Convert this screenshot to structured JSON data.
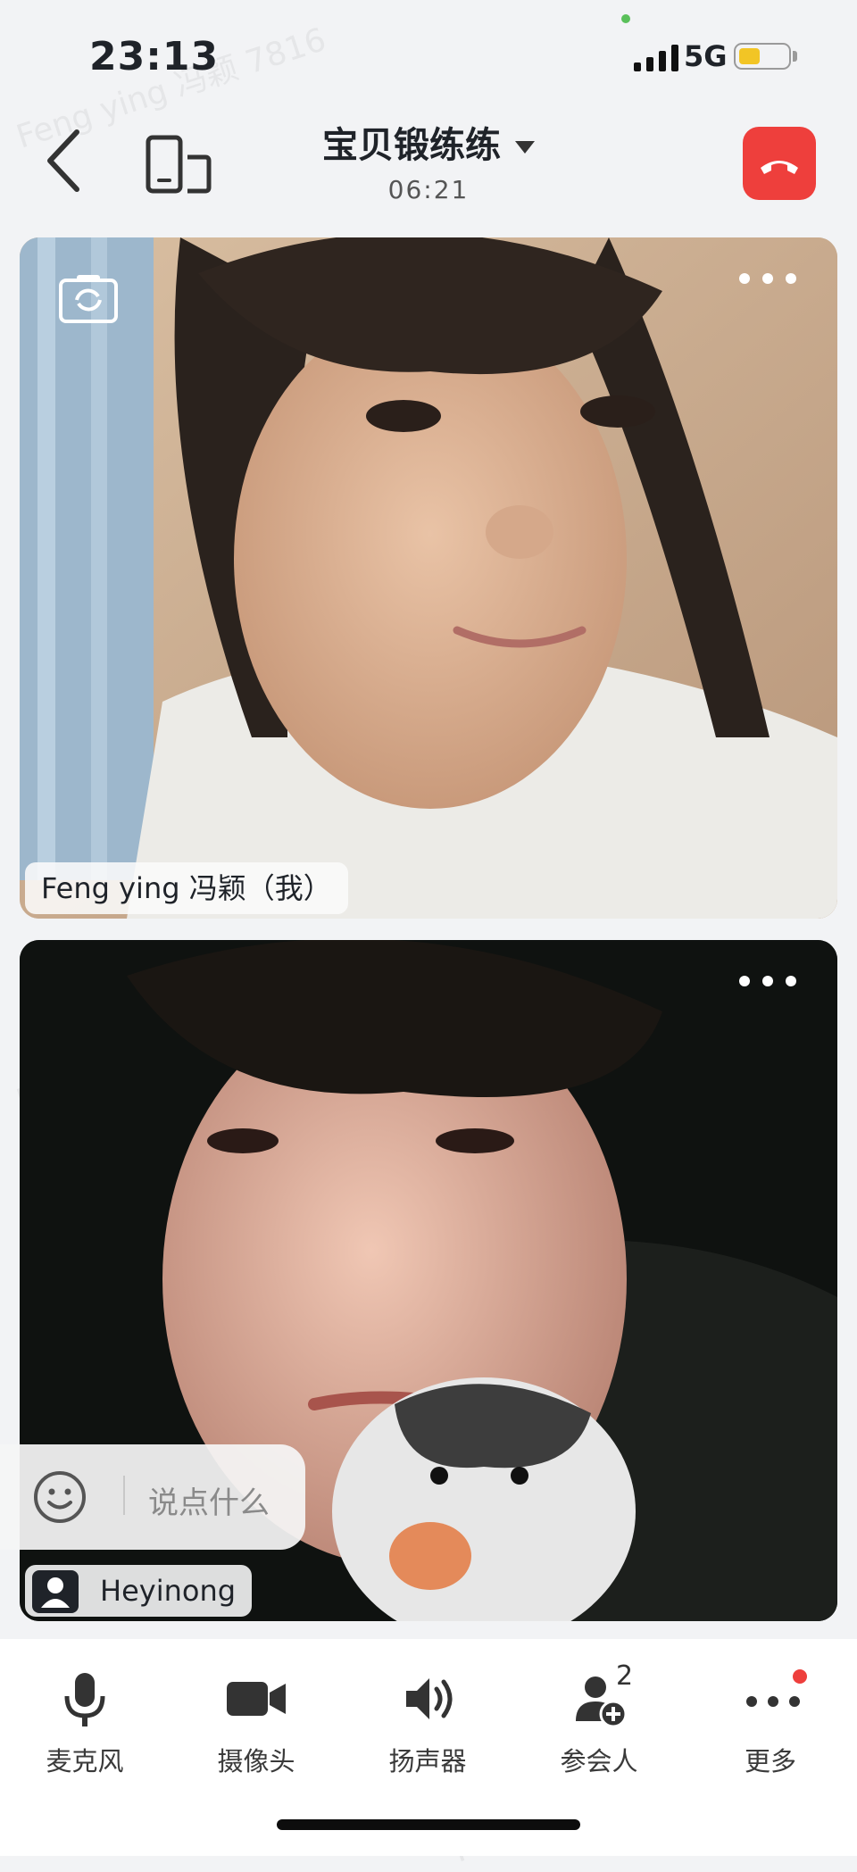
{
  "status_bar": {
    "time": "23:13",
    "network": "5G",
    "battery_level": 0.45
  },
  "header": {
    "title": "宝贝锻练练",
    "duration": "06:21"
  },
  "participants": [
    {
      "name": "Feng ying 冯颖（我）"
    },
    {
      "name": "Heyinong"
    }
  ],
  "chat": {
    "placeholder": "说点什么"
  },
  "toolbar": [
    {
      "label": "麦克风",
      "icon": "microphone-icon"
    },
    {
      "label": "摄像头",
      "icon": "camera-icon"
    },
    {
      "label": "扬声器",
      "icon": "speaker-icon"
    },
    {
      "label": "参会人",
      "icon": "participants-icon",
      "count": "2"
    },
    {
      "label": "更多",
      "icon": "more-icon"
    }
  ],
  "watermark": "Feng ying 冯颖 7816",
  "colors": {
    "hangup": "#ee3f3c",
    "battery": "#f2c525",
    "accent_dot": "#ee3f3c"
  }
}
